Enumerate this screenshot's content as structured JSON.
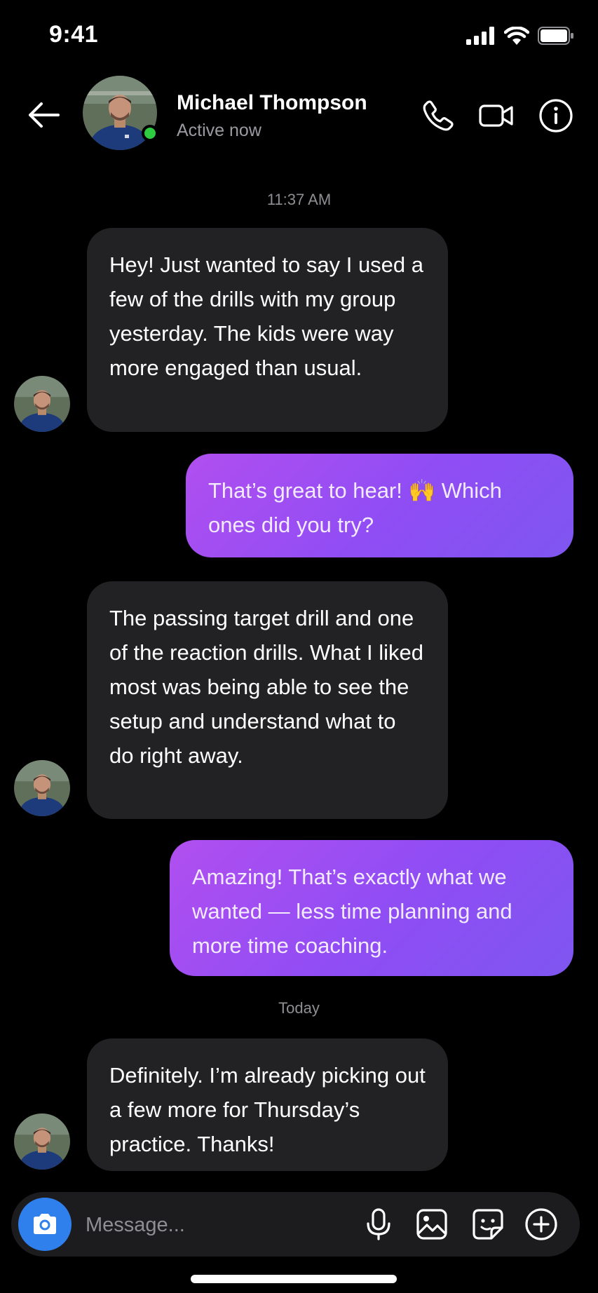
{
  "status_bar": {
    "time": "9:41"
  },
  "header": {
    "name": "Michael Thompson",
    "status": "Active now"
  },
  "conversation": {
    "timestamp_1": "11:37 AM",
    "messages": [
      {
        "direction": "incoming",
        "text": "Hey! Just wanted to say I used a few of the drills with my group yesterday. The kids were way more engaged than usual."
      },
      {
        "direction": "outgoing",
        "text": "That’s great to hear! 🙌 Which ones did you try?"
      },
      {
        "direction": "incoming",
        "text": "The passing target drill and one of the reaction drills. What I liked most was being able to see the setup and understand what to do right away."
      },
      {
        "direction": "outgoing",
        "text": "Amazing! That’s exactly what we wanted — less time planning and more time coaching."
      },
      {
        "direction": "incoming",
        "text": "Definitely. I’m already picking out a few more for Thursday’s practice. Thanks!"
      }
    ],
    "timestamp_2": "Today"
  },
  "composer": {
    "placeholder": "Message...",
    "icons": [
      "camera-icon",
      "microphone-icon",
      "image-icon",
      "sticker-icon",
      "plus-icon"
    ]
  },
  "colors": {
    "background": "#000000",
    "incoming_bubble": "#222224",
    "outgoing_gradient_start": "#b14ff0",
    "outgoing_gradient_end": "#7e56f0",
    "camera_button": "#2f80ed",
    "online_dot": "#2ecc40"
  }
}
